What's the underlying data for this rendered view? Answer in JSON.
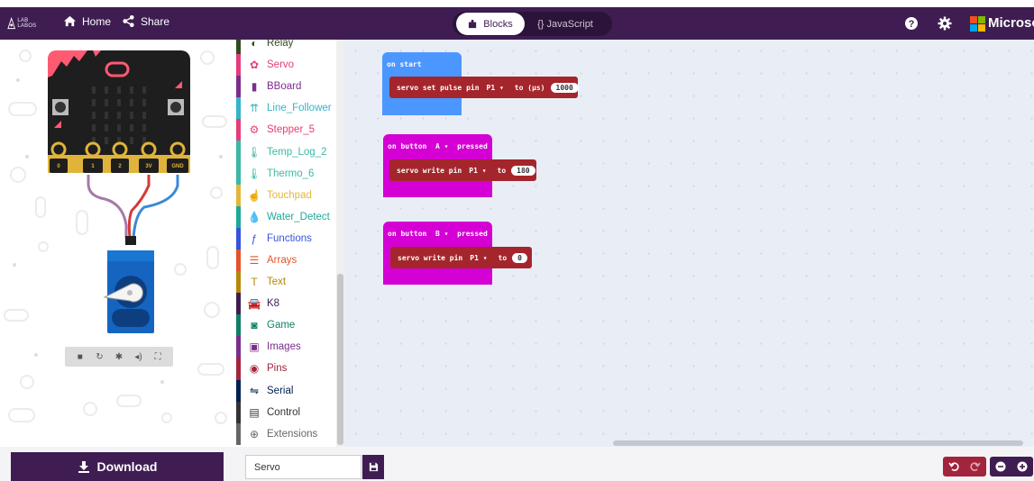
{
  "header": {
    "logo_text": "LAB LABOS",
    "home_label": "Home",
    "share_label": "Share",
    "blocks_tab": "Blocks",
    "javascript_tab": "{} JavaScript",
    "brand": "Microsoft",
    "colors": {
      "bar": "#3f1d52",
      "toggle": "#2c1339"
    }
  },
  "simulator": {
    "pin_labels": [
      "0",
      "1",
      "2",
      "3V",
      "GND"
    ],
    "controls": [
      "stop-icon",
      "restart-icon",
      "debug-icon",
      "mute-icon",
      "fullscreen-icon"
    ]
  },
  "toolbox": {
    "categories": [
      {
        "label": "Relay",
        "color": "#334a22",
        "icon": "toggle-icon"
      },
      {
        "label": "Servo",
        "color": "#e53d7a",
        "icon": "gear-icon"
      },
      {
        "label": "BBoard",
        "color": "#7b2d8e",
        "icon": "board-icon"
      },
      {
        "label": "Line_Follower",
        "color": "#33b4c9",
        "icon": "arrows-up-icon"
      },
      {
        "label": "Stepper_5",
        "color": "#e53d7a",
        "icon": "gears-icon"
      },
      {
        "label": "Temp_Log_2",
        "color": "#3cb8a6",
        "icon": "thermometer-icon"
      },
      {
        "label": "Thermo_6",
        "color": "#3cb8a6",
        "icon": "thermometer-icon"
      },
      {
        "label": "Touchpad",
        "color": "#e4b63a",
        "icon": "hand-icon"
      },
      {
        "label": "Water_Detect",
        "color": "#20a89a",
        "icon": "droplet-icon"
      },
      {
        "label": "Functions",
        "color": "#3455db",
        "icon": "function-icon"
      },
      {
        "label": "Arrays",
        "color": "#e2542b",
        "icon": "list-icon"
      },
      {
        "label": "Text",
        "color": "#b8860b",
        "icon": "text-icon"
      },
      {
        "label": "K8",
        "color": "#3f1d52",
        "icon": "car-icon"
      },
      {
        "label": "Game",
        "color": "#0e7f64",
        "icon": "gamepad-icon"
      },
      {
        "label": "Images",
        "color": "#7b2d8e",
        "icon": "image-icon"
      },
      {
        "label": "Pins",
        "color": "#a3243d",
        "icon": "target-icon"
      },
      {
        "label": "Serial",
        "color": "#002050",
        "icon": "usb-icon"
      },
      {
        "label": "Control",
        "color": "#333333",
        "icon": "chip-icon"
      },
      {
        "label": "Extensions",
        "color": "#666666",
        "icon": "plus-circle-icon"
      }
    ]
  },
  "workspace": {
    "on_start": {
      "title": "on start",
      "color": "#4c97ff",
      "statement": {
        "text": "servo set pulse pin",
        "pin": "P1 ▾",
        "to": "to (µs)",
        "value": "1000"
      }
    },
    "button_a": {
      "title_prefix": "on button",
      "button": "A ▾",
      "title_suffix": "pressed",
      "color": "#d400d4",
      "statement": {
        "text": "servo write pin",
        "pin": "P1 ▾",
        "to": "to",
        "value": "180"
      }
    },
    "button_b": {
      "title_prefix": "on button",
      "button": "B ▾",
      "title_suffix": "pressed",
      "color": "#d400d4",
      "statement": {
        "text": "servo write pin",
        "pin": "P1 ▾",
        "to": "to",
        "value": "0"
      }
    }
  },
  "footer": {
    "download_label": "Download",
    "project_name": "Servo"
  }
}
